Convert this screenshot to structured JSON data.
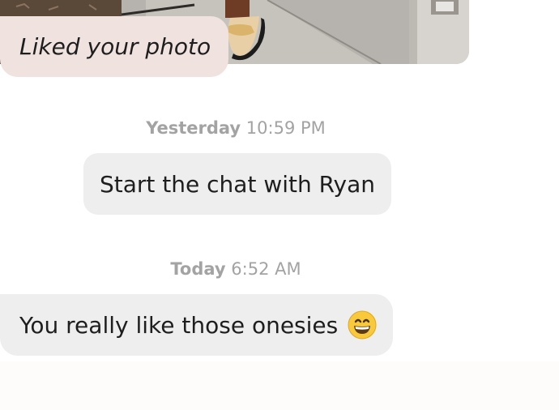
{
  "liked_photo": {
    "caption": "Liked your photo"
  },
  "messages": [
    {
      "timestamp_day": "Yesterday",
      "timestamp_time": "10:59 PM",
      "text": "Start the chat with Ryan"
    },
    {
      "timestamp_day": "Today",
      "timestamp_time": "6:52 AM",
      "text": "You really like those onesies",
      "emoji": "grinning-face-icon"
    }
  ],
  "colors": {
    "liked_bubble_bg": "#efe2df",
    "message_bubble_bg": "#eeeeee",
    "timestamp_text": "#a3a3a3",
    "message_text": "#1e1e1e"
  }
}
